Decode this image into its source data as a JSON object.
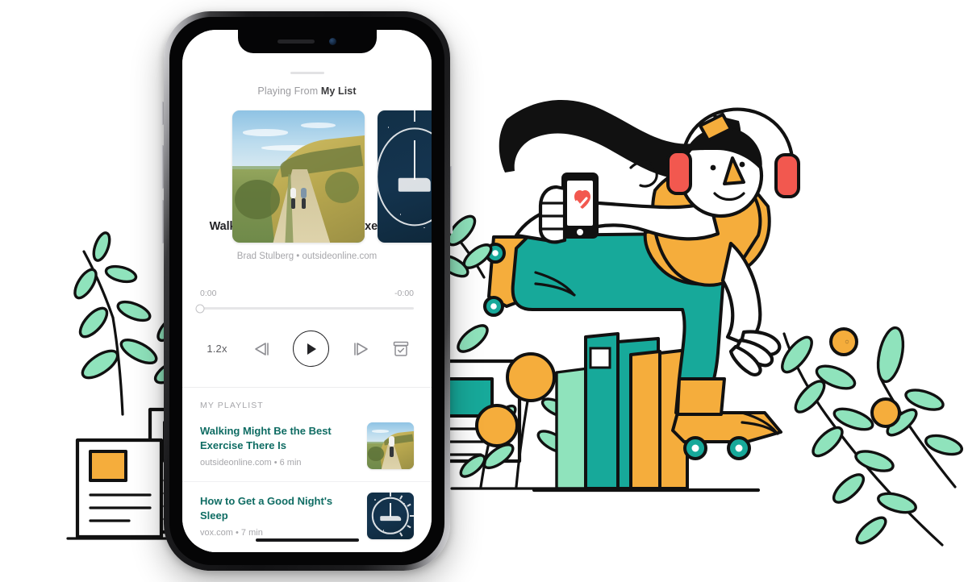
{
  "app": {
    "playing_from_prefix": "Playing From",
    "playing_from_source": "My List",
    "now_playing": {
      "title": "Walking Might Be the Best Exercise There Is",
      "byline": "Brad Stulberg • outsideonline.com",
      "artwork_name": "hill-walk-photo",
      "next_artwork_name": "night-clock-illustration"
    },
    "progress": {
      "elapsed": "0:00",
      "remaining": "-0:00",
      "percent": 0
    },
    "controls": {
      "speed_label": "1.2x",
      "previous_label": "previous-track",
      "play_label": "play",
      "next_label": "next-track",
      "archive_label": "archive"
    },
    "playlist": {
      "heading": "MY PLAYLIST",
      "items": [
        {
          "title": "Walking Might Be the Best Exercise There Is",
          "meta": "outsideonline.com • 6 min",
          "thumb": "hill-walk-photo"
        },
        {
          "title": "How to Get a Good Night's Sleep",
          "meta": "vox.com • 7 min",
          "thumb": "night-clock-illustration"
        }
      ]
    }
  },
  "colors": {
    "teal": "#17a99a",
    "teal_dark": "#0f6c63",
    "mint": "#8fe3bc",
    "yellow": "#f5ad3c",
    "coral": "#f2584f",
    "ink": "#111111",
    "page_bg": "#ffffff"
  },
  "illustration": {
    "name": "person-on-skateboard-with-headphones",
    "elements": [
      "long-black-hair",
      "red-headphones",
      "yellow-shirt",
      "teal-pants",
      "skateboard",
      "held-phone-with-heart",
      "stacked-books",
      "newspapers",
      "leafy-plants",
      "orange-berries"
    ]
  }
}
